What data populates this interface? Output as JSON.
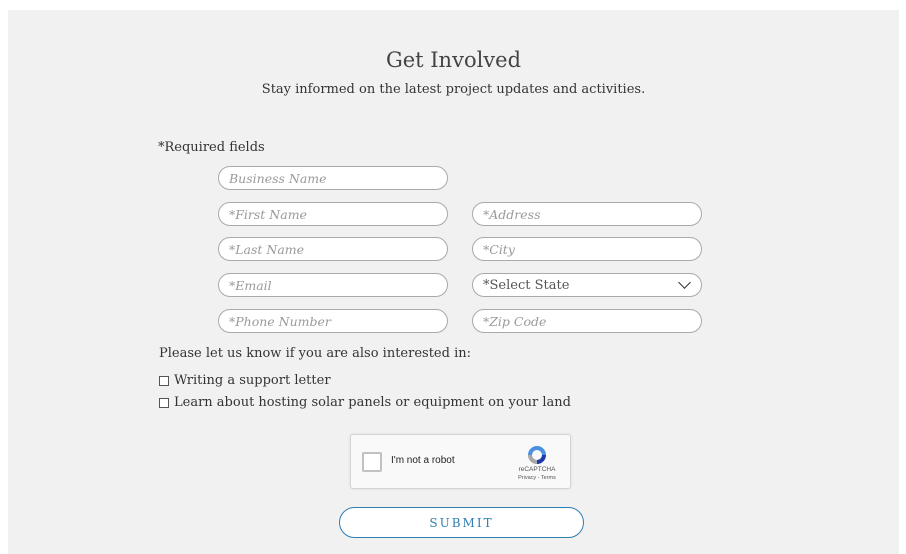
{
  "header": {
    "title": "Get Involved",
    "subtitle": "Stay informed on the latest project updates and activities."
  },
  "form": {
    "required_note": "*Required fields",
    "fields": {
      "business_name": {
        "placeholder": "Business Name",
        "value": ""
      },
      "first_name": {
        "placeholder": "*First Name",
        "value": ""
      },
      "last_name": {
        "placeholder": "*Last Name",
        "value": ""
      },
      "email": {
        "placeholder": "*Email",
        "value": ""
      },
      "phone": {
        "placeholder": "*Phone Number",
        "value": ""
      },
      "address": {
        "placeholder": "*Address",
        "value": ""
      },
      "city": {
        "placeholder": "*City",
        "value": ""
      },
      "state": {
        "selected": "*Select State"
      },
      "zip": {
        "placeholder": "*Zip Code",
        "value": ""
      }
    },
    "interest_prompt": "Please let us know if you are also interested in:",
    "interests": [
      {
        "label": "Writing a support letter",
        "checked": false
      },
      {
        "label": "Learn about hosting solar panels or equipment on your land",
        "checked": false
      }
    ],
    "recaptcha": {
      "label": "I'm not a robot",
      "brand": "reCAPTCHA",
      "links": "Privacy - Terms"
    },
    "submit_label": "SUBMIT"
  },
  "colors": {
    "panel_background": "#f1f1f1",
    "accent": "#2d7eb3"
  }
}
